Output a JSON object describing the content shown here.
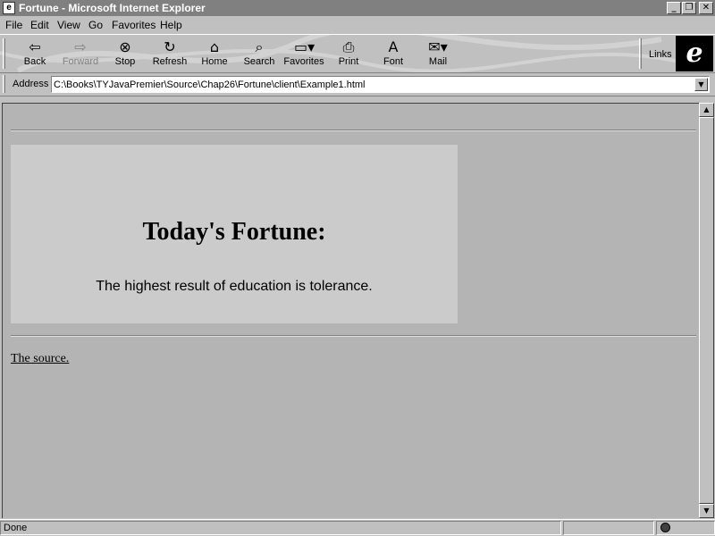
{
  "window": {
    "title": "Fortune - Microsoft Internet Explorer",
    "controls": {
      "minimize": "_",
      "maximize": "❐",
      "close": "✕"
    }
  },
  "menu": {
    "items": [
      {
        "label": "File"
      },
      {
        "label": "Edit"
      },
      {
        "label": "View"
      },
      {
        "label": "Go"
      },
      {
        "label": "Favorites"
      },
      {
        "label": "Help"
      }
    ]
  },
  "toolbar": {
    "buttons": [
      {
        "label": "Back",
        "icon": "back-arrow-icon",
        "enabled": true
      },
      {
        "label": "Forward",
        "icon": "forward-arrow-icon",
        "enabled": false
      },
      {
        "label": "Stop",
        "icon": "stop-icon",
        "enabled": true
      },
      {
        "label": "Refresh",
        "icon": "refresh-icon",
        "enabled": true
      },
      {
        "label": "Home",
        "icon": "home-icon",
        "enabled": true
      },
      {
        "label": "Search",
        "icon": "search-icon",
        "enabled": true
      },
      {
        "label": "Favorites",
        "icon": "favorites-folder-icon",
        "enabled": true
      },
      {
        "label": "Print",
        "icon": "printer-icon",
        "enabled": true
      },
      {
        "label": "Font",
        "icon": "font-icon",
        "enabled": true
      },
      {
        "label": "Mail",
        "icon": "mail-icon",
        "enabled": true
      }
    ],
    "links_label": "Links"
  },
  "address": {
    "label": "Address",
    "value": "C:\\Books\\TYJavaPremier\\Source\\Chap26\\Fortune\\client\\Example1.html"
  },
  "content": {
    "heading": "Today's Fortune:",
    "fortune": "The highest result of education is tolerance.",
    "source_link": "The source."
  },
  "status": {
    "text": "Done"
  }
}
